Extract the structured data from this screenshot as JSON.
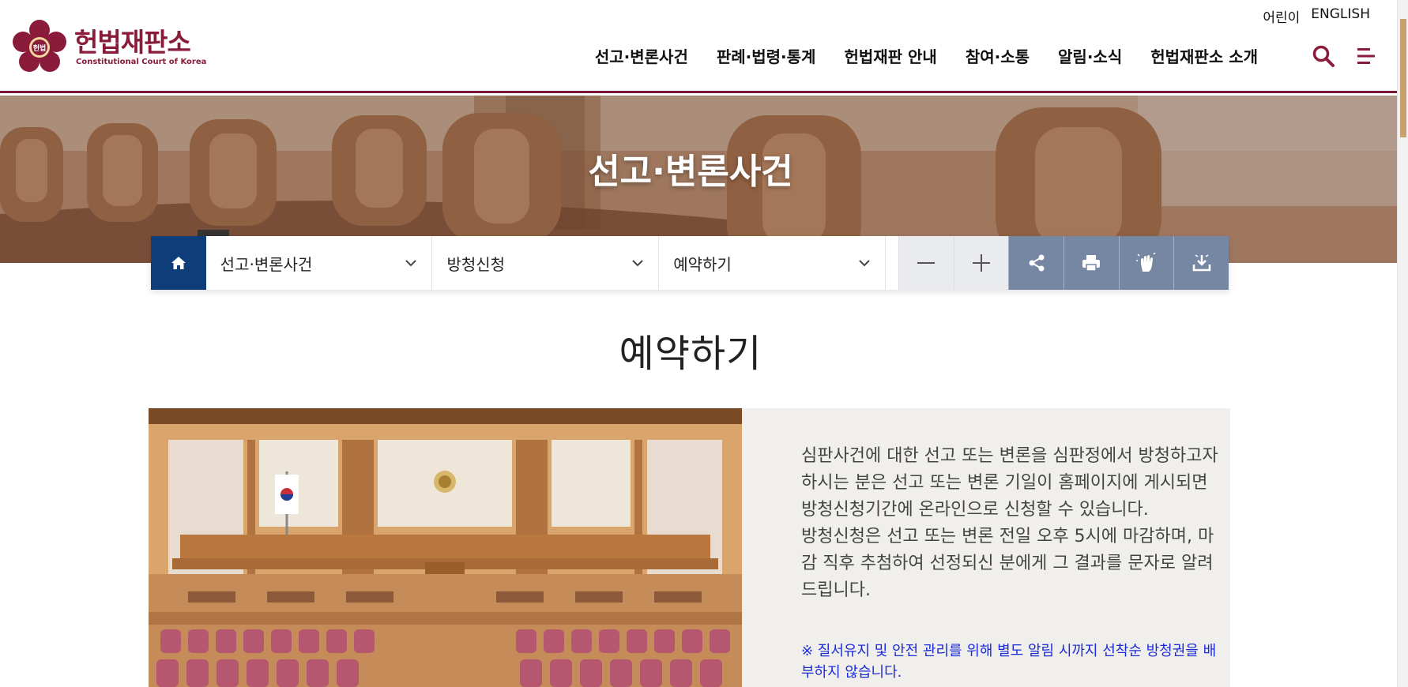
{
  "header": {
    "logo_title": "헌법재판소",
    "logo_subtitle": "Constitutional Court of Korea",
    "logo_seal_text": "헌법",
    "util_links": [
      "어린이",
      "ENGLISH"
    ],
    "nav": [
      "선고·변론사건",
      "판례·법령·통계",
      "헌법재판 안내",
      "참여·소통",
      "알림·소식",
      "헌법재판소 소개"
    ],
    "search_icon": "search-icon",
    "menu_icon": "hamburger-menu-icon"
  },
  "hero": {
    "title": "선고·변론사건"
  },
  "location": {
    "home_icon": "home-icon",
    "depth1": "선고·변론사건",
    "depth2": "방청신청",
    "depth3": "예약하기",
    "tools": [
      "zoom-out-icon",
      "zoom-in-icon",
      "share-icon",
      "print-icon",
      "gesture-icon",
      "download-icon"
    ]
  },
  "page": {
    "title": "예약하기",
    "description": [
      "심판사건에 대한 선고 또는 변론을 심판정에서 방청하고자 하시는 분은 선고 또는 변론 기일이 홈페이지에 게시되면 방청신청기간에 온라인으로 신청할 수 있습니다.",
      "방청신청은 선고 또는 변론 전일 오후 5시에 마감하며, 마감 직후 추첨하여 선정되신 분에게 그 결과를 문자로 알려 드립니다."
    ],
    "notice": "※ 질서유지 및 안전 관리를 위해 별도 알림 시까지 선착순 방청권을 배부하지 않습니다."
  },
  "colors": {
    "brand": "#8a1b3a",
    "home_bg": "#0f3d7a",
    "tool_blue": "#7687a4",
    "notice": "#1a2bd8"
  }
}
